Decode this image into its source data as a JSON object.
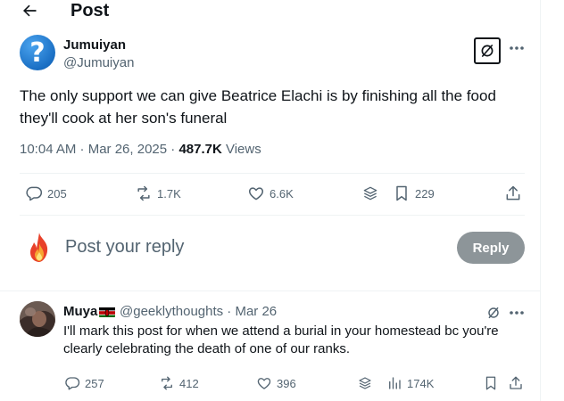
{
  "header": {
    "title": "Post",
    "back_icon": "arrow-left-icon"
  },
  "tweet": {
    "author_name": "Jumuiyan",
    "author_handle": "@Jumuiyan",
    "avatar_glyph": "?",
    "text": "The only support we can give Beatrice Elachi is by finishing all the food they'll cook at her son's funeral",
    "time": "10:04 AM · Mar 26, 2025 · ",
    "views_count": "487.7K",
    "views_label": " Views",
    "actions": {
      "replies": "205",
      "reposts": "1.7K",
      "likes": "6.6K",
      "bookmarks": "229"
    }
  },
  "composer": {
    "placeholder": "Post your reply",
    "button_label": "Reply"
  },
  "reply": {
    "author_name": "Muya",
    "author_handle": "@geeklythoughts · Mar 26",
    "text": "I'll mark this post for when we attend a burial in your homestead bc you're clearly celebrating the death of one of our ranks.",
    "actions": {
      "replies": "257",
      "reposts": "412",
      "likes": "396",
      "views": "174K"
    }
  },
  "colors": {
    "text_primary": "#0f1419",
    "text_secondary": "#536471",
    "divider": "#eff3f4",
    "reply_button_bg": "#8d9599",
    "avatar_blue": "#1a6fc4"
  }
}
